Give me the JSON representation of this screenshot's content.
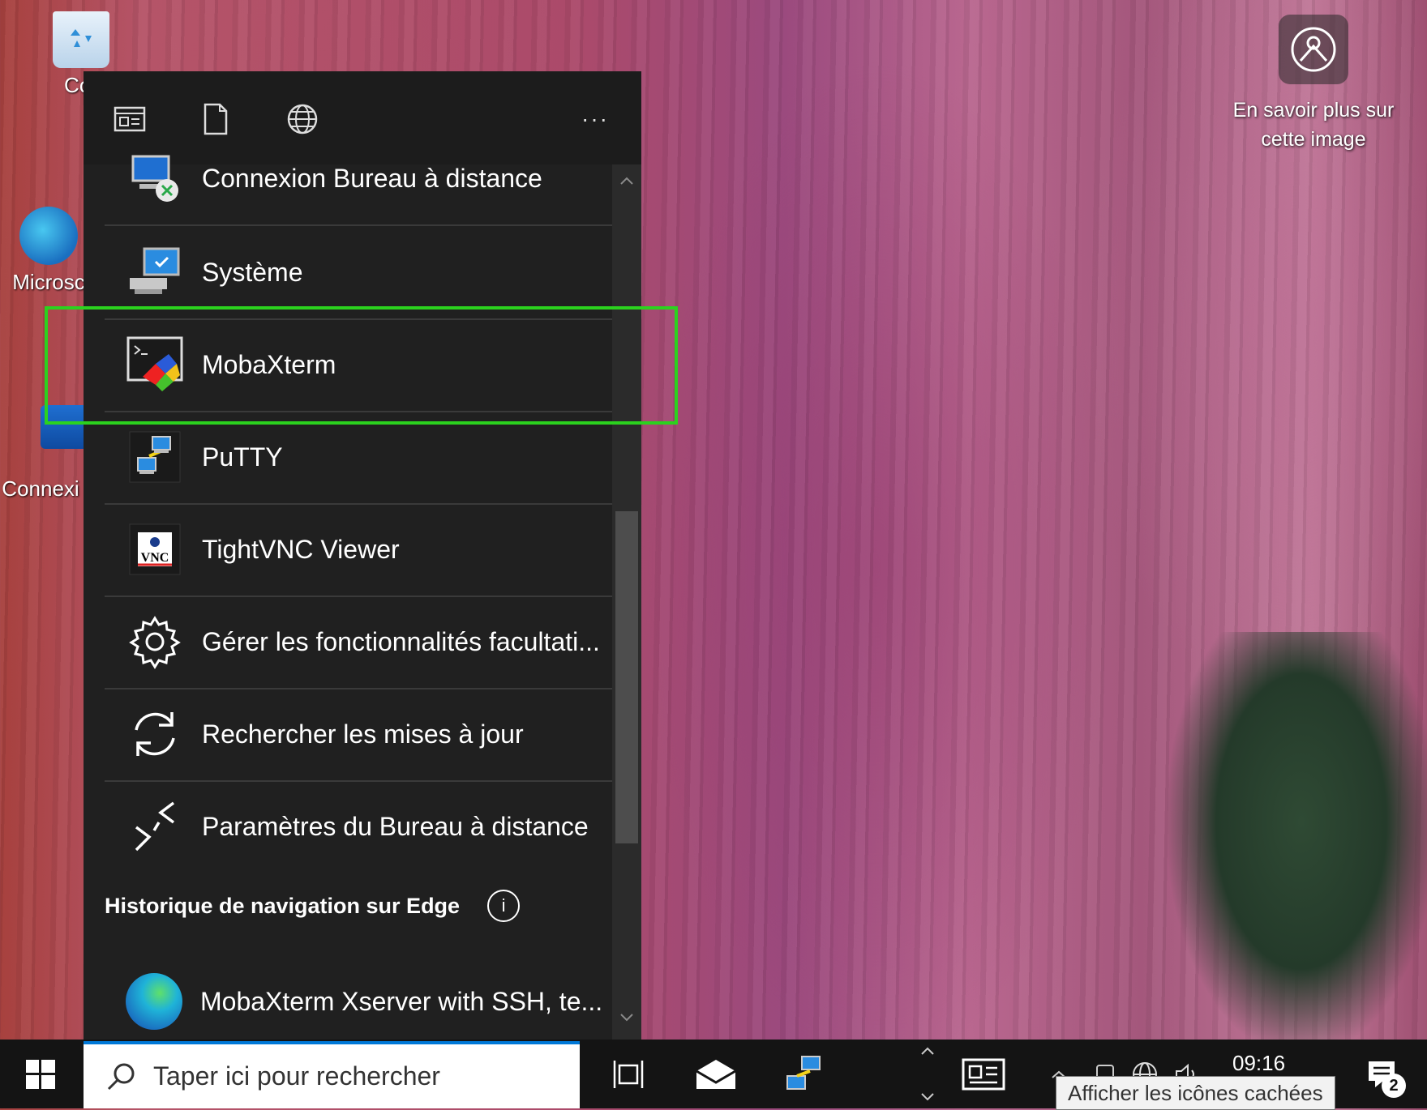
{
  "desktop": {
    "icons": [
      {
        "label": "Cor"
      },
      {
        "label": "Microsc"
      },
      {
        "label": "Connexi"
      }
    ],
    "learn_more": {
      "label_line1": "En savoir plus sur",
      "label_line2": "cette image"
    }
  },
  "flyout": {
    "toolbar": {
      "more_label": "···"
    },
    "results": [
      {
        "label": "Connexion Bureau à distance",
        "icon": "remote-desktop-icon"
      },
      {
        "label": "Système",
        "icon": "system-computer-icon"
      },
      {
        "label": "MobaXterm",
        "icon": "mobaxterm-icon"
      },
      {
        "label": "PuTTY",
        "icon": "putty-icon"
      },
      {
        "label": "TightVNC Viewer",
        "icon": "tightvnc-icon"
      },
      {
        "label": "Gérer les fonctionnalités facultati...",
        "icon": "gear-icon"
      },
      {
        "label": "Rechercher les mises à jour",
        "icon": "refresh-icon"
      },
      {
        "label": "Paramètres du Bureau à distance",
        "icon": "remote-settings-icon"
      }
    ],
    "section": {
      "title": "Historique de navigation sur Edge",
      "info": "i"
    },
    "edge_item": {
      "label": "MobaXterm Xserver with SSH, te..."
    }
  },
  "taskbar": {
    "search_placeholder": "Taper ici pour rechercher",
    "clock": "09:16",
    "tooltip": "Afficher les icônes cachées",
    "notification_count": "2",
    "colors": {
      "accent": "#0078d7",
      "highlight": "#2bd21e"
    }
  }
}
